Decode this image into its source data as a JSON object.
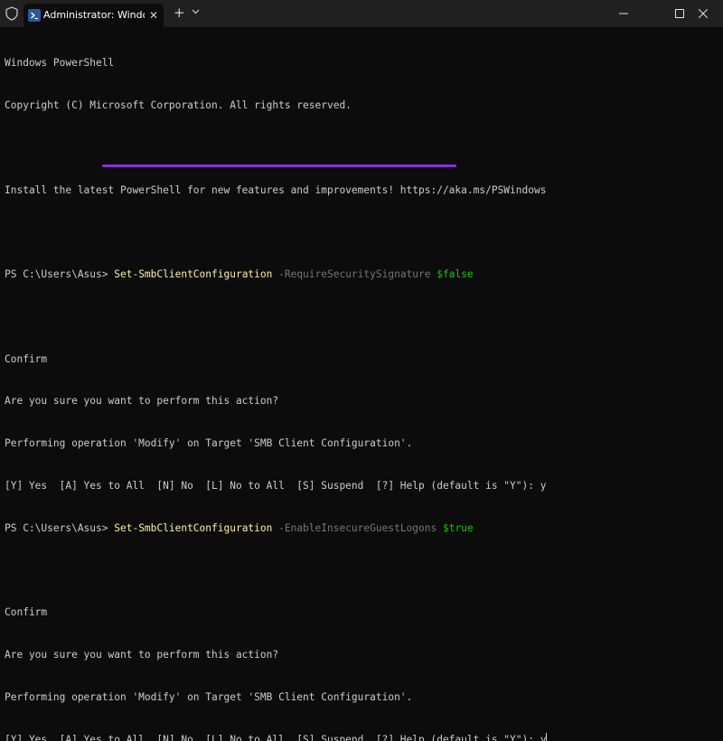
{
  "titlebar": {
    "tab_title": "Administrator: Windows PowerShell",
    "close_glyph": "✕",
    "new_tab_glyph": "+",
    "dropdown_glyph": "⌄",
    "minimize_glyph": "—",
    "maximize_glyph": "☐",
    "window_close_glyph": "✕"
  },
  "terminal": {
    "banner1": "Windows PowerShell",
    "banner2": "Copyright (C) Microsoft Corporation. All rights reserved.",
    "banner3": "Install the latest PowerShell for new features and improvements! https://aka.ms/PSWindows",
    "cmd1": {
      "prompt": "PS C:\\Users\\Asus> ",
      "cmdlet": "Set-SmbClientConfiguration",
      "param": " -RequireSecuritySignature",
      "value": " $false"
    },
    "confirm1": {
      "title": "Confirm",
      "question": "Are you sure you want to perform this action?",
      "operation": "Performing operation 'Modify' on Target 'SMB Client Configuration'.",
      "options": "[Y] Yes  [A] Yes to All  [N] No  [L] No to All  [S] Suspend  [?] Help (default is \"Y\"): y"
    },
    "cmd2": {
      "prompt": "PS C:\\Users\\Asus> ",
      "cmdlet": "Set-SmbClientConfiguration",
      "param": " -EnableInsecureGuestLogons",
      "value": " $true"
    },
    "confirm2": {
      "title": "Confirm",
      "question": "Are you sure you want to perform this action?",
      "operation": "Performing operation 'Modify' on Target 'SMB Client Configuration'.",
      "options": "[Y] Yes  [A] Yes to All  [N] No  [L] No to All  [S] Suspend  [?] Help (default is \"Y\"): y"
    }
  },
  "colors": {
    "background": "#0c0c0c",
    "titlebar": "#202020",
    "cmdlet": "#f9f1a5",
    "parameter": "#767676",
    "value": "#16c60c",
    "highlight_underline": "#8a2be2"
  }
}
